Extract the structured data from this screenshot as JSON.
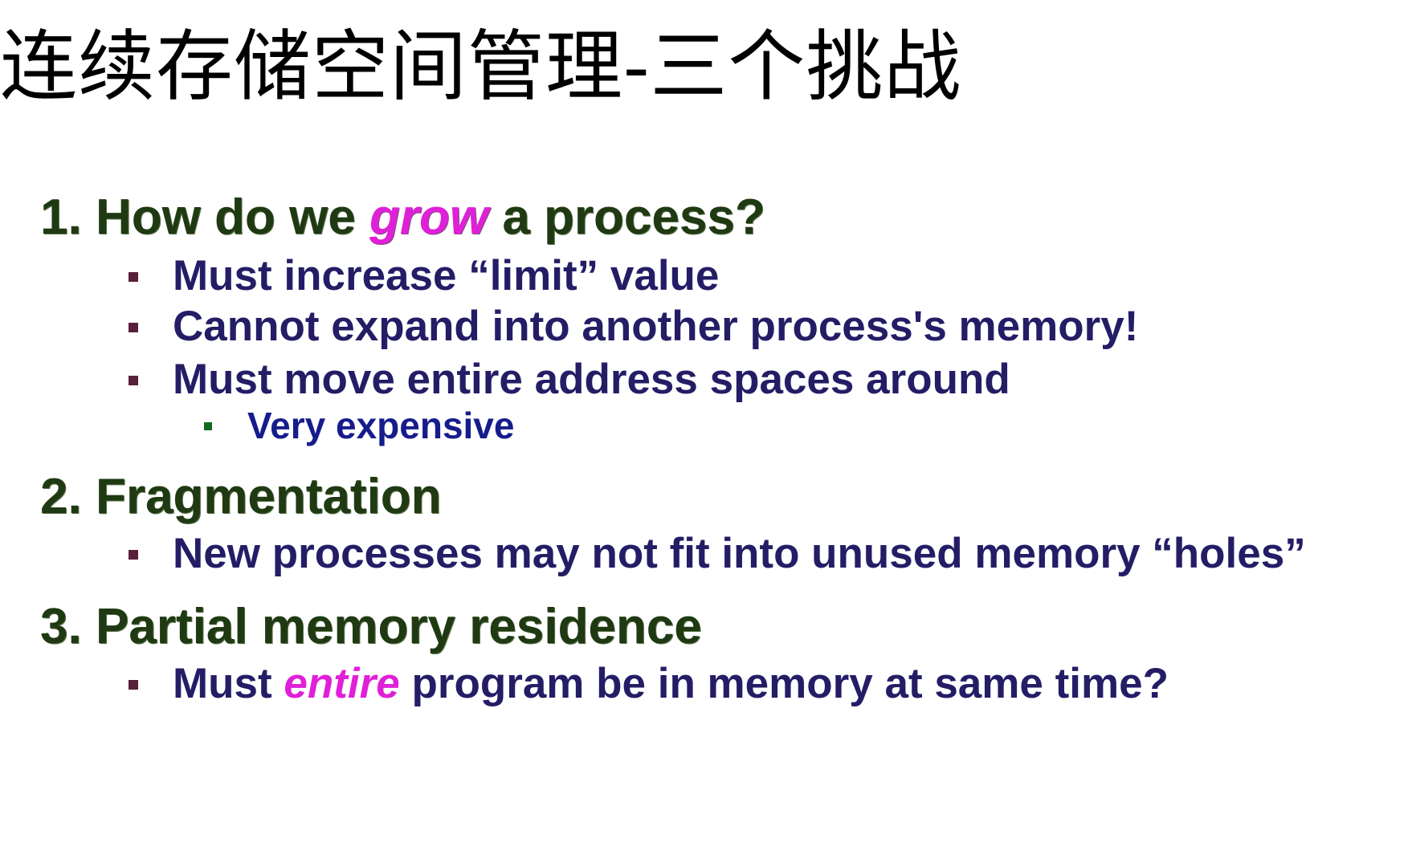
{
  "title": "连续存储空间管理-三个挑战",
  "sections": [
    {
      "number": "1.",
      "heading_before": "How do we",
      "heading_emphasis": "grow",
      "heading_after": "a process?",
      "bullets": [
        "Must increase “limit” value",
        "Cannot expand into another process's memory!",
        "Must move entire address spaces around"
      ],
      "sub_bullets": [
        "Very expensive"
      ]
    },
    {
      "number": "2.",
      "heading": "Fragmentation",
      "bullets": [
        "New processes may not fit into unused memory “holes”"
      ]
    },
    {
      "number": "3.",
      "heading": "Partial memory residence",
      "bullets": [
        {
          "before": "Must",
          "emphasis": "entire",
          "after": "program be in memory at same time?"
        }
      ]
    }
  ],
  "colors": {
    "heading": "#1f3a12",
    "emphasis": "#e020d8",
    "bullet_text": "#241d66",
    "sub_bullet_text": "#161c8c",
    "bullet_marker": "#5a1f3a",
    "sub_bullet_marker": "#0f6a20"
  }
}
